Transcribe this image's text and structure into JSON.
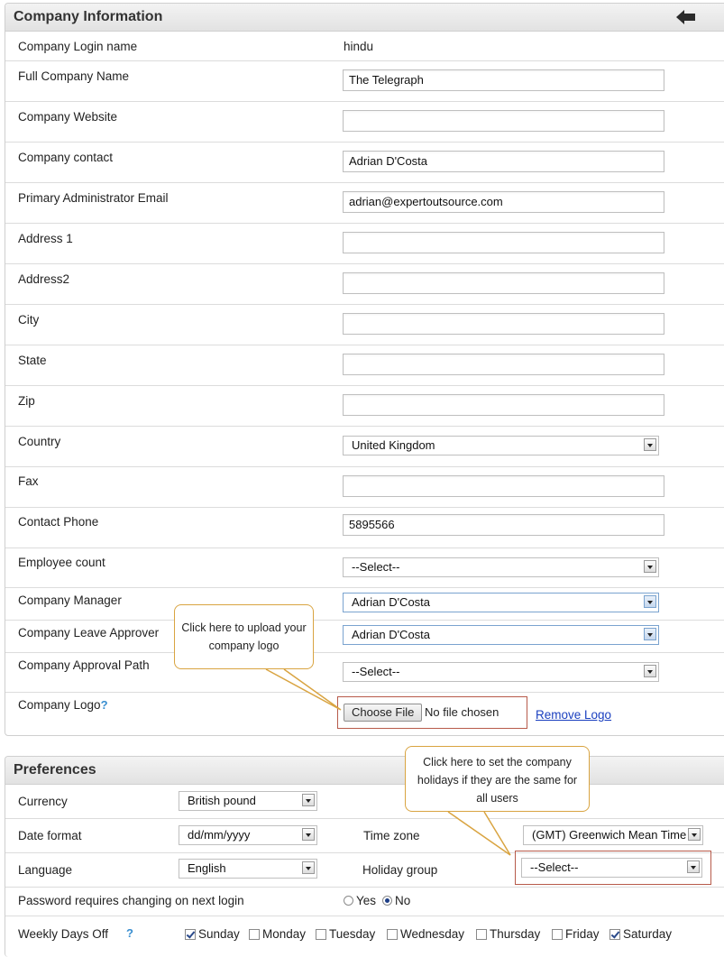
{
  "company_info": {
    "title": "Company Information",
    "back_icon": "back-arrow-icon",
    "fields": {
      "login_name": {
        "label": "Company Login name",
        "value": "hindu"
      },
      "full_name": {
        "label": "Full Company Name",
        "value": "The Telegraph"
      },
      "website": {
        "label": "Company Website",
        "value": ""
      },
      "contact": {
        "label": "Company contact",
        "value": "Adrian D'Costa"
      },
      "admin_email": {
        "label": "Primary Administrator Email",
        "value": "adrian@expertoutsource.com"
      },
      "address1": {
        "label": "Address 1",
        "value": ""
      },
      "address2": {
        "label": "Address2",
        "value": ""
      },
      "city": {
        "label": "City",
        "value": ""
      },
      "state": {
        "label": "State",
        "value": ""
      },
      "zip": {
        "label": "Zip",
        "value": ""
      },
      "country": {
        "label": "Country",
        "value": "United Kingdom"
      },
      "fax": {
        "label": "Fax",
        "value": ""
      },
      "phone": {
        "label": "Contact Phone",
        "value": "5895566"
      },
      "employee_count": {
        "label": "Employee count",
        "value": "--Select--"
      },
      "manager": {
        "label": "Company Manager",
        "value": "Adrian D'Costa"
      },
      "leave_approver": {
        "label": "Company Leave Approver",
        "value": "Adrian D'Costa"
      },
      "approval_path": {
        "label": "Company Approval Path",
        "value": "--Select--"
      },
      "logo": {
        "label": "Company Logo",
        "help": "?",
        "choose_label": "Choose File",
        "file_status": "No file chosen",
        "remove_label": "Remove Logo"
      }
    },
    "logo_callout": "Click here to upload your company logo"
  },
  "preferences": {
    "title": "Preferences",
    "currency": {
      "label": "Currency",
      "value": "British pound"
    },
    "date_format": {
      "label": "Date format",
      "value": "dd/mm/yyyy"
    },
    "time_zone": {
      "label": "Time zone",
      "value": "(GMT) Greenwich Mean Time"
    },
    "language": {
      "label": "Language",
      "value": "English"
    },
    "holiday_group": {
      "label": "Holiday group",
      "value": "--Select--"
    },
    "password_change": {
      "label": "Password requires changing on next login",
      "yes": "Yes",
      "no": "No",
      "selected": "No"
    },
    "weekly_off": {
      "label": "Weekly Days Off",
      "help": "?",
      "days": [
        {
          "name": "Sunday",
          "checked": true
        },
        {
          "name": "Monday",
          "checked": false
        },
        {
          "name": "Tuesday",
          "checked": false
        },
        {
          "name": "Wednesday",
          "checked": false
        },
        {
          "name": "Thursday",
          "checked": false
        },
        {
          "name": "Friday",
          "checked": false
        },
        {
          "name": "Saturday",
          "checked": true
        }
      ]
    },
    "holiday_callout": "Click here to set the company holidays if they are the same for all users"
  },
  "colors": {
    "callout_border": "#d9a441",
    "highlight_border": "#b75a4a",
    "link": "#1a3fbf"
  }
}
